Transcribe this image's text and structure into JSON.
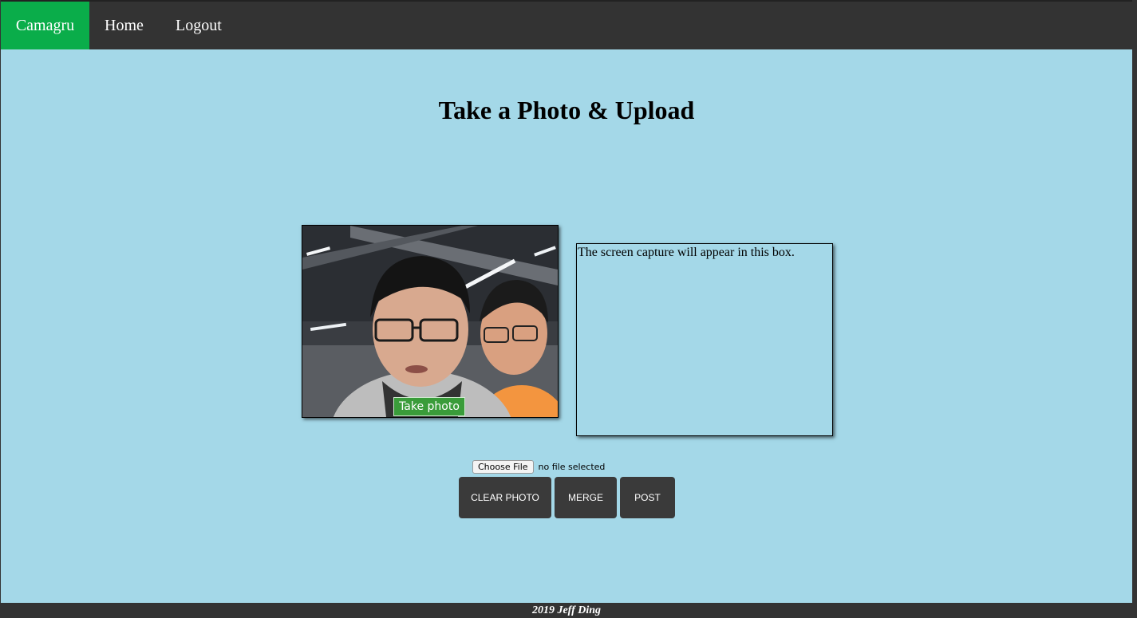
{
  "nav": {
    "brand": "Camagru",
    "home": "Home",
    "logout": "Logout",
    "brand_color": "#0aad4a",
    "bar_color": "#333333"
  },
  "main": {
    "title": "Take a Photo & Upload",
    "take_photo_label": "Take photo",
    "capture_placeholder": "The screen capture will appear in this box.",
    "file_button_label": "Choose File",
    "file_status": "no file selected",
    "buttons": {
      "clear": "CLEAR PHOTO",
      "merge": "MERGE",
      "post": "POST"
    },
    "background_color": "#a4d8e8"
  },
  "footer": {
    "text": "2019 Jeff Ding"
  }
}
